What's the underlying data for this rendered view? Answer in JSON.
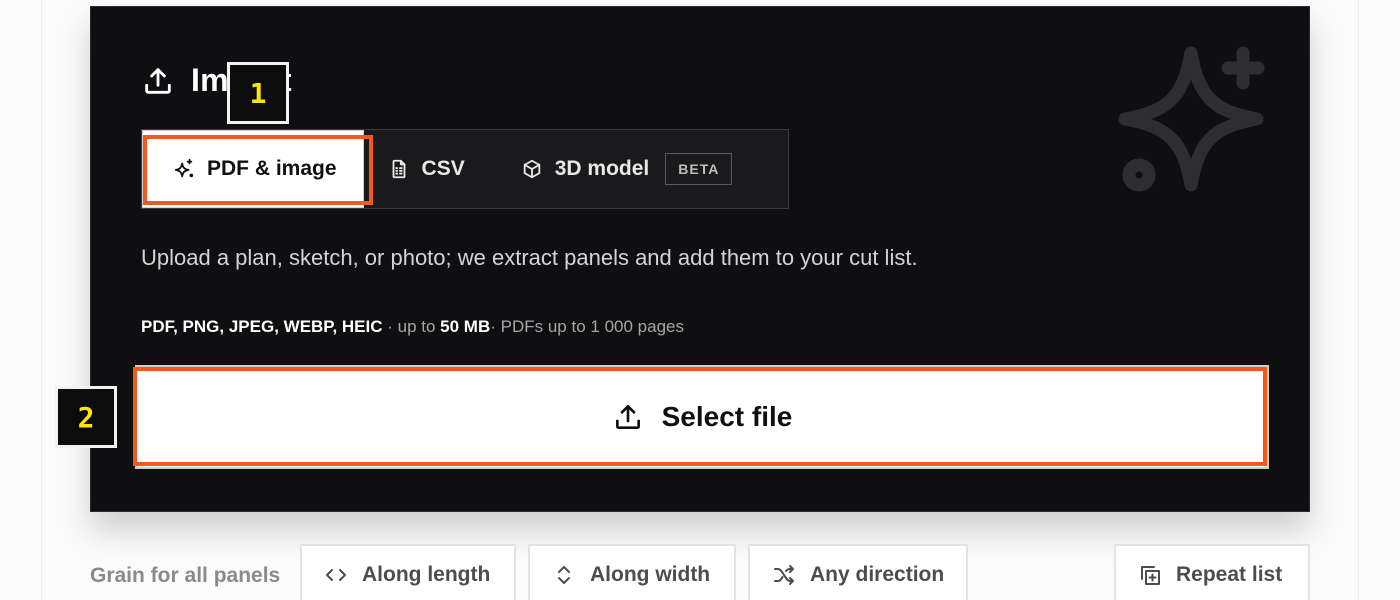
{
  "panel": {
    "title": "Import",
    "tabs": [
      {
        "label": "PDF & image",
        "icon": "sparkles-icon",
        "active": true
      },
      {
        "label": "CSV",
        "icon": "csv-file-icon",
        "active": false
      },
      {
        "label": "3D model",
        "icon": "cube-icon",
        "active": false,
        "badge": "BETA"
      }
    ],
    "description": "Upload a plan, sketch, or photo; we extract panels and add them to your cut list.",
    "formats": {
      "types": "PDF, PNG, JPEG, WEBP, HEIC",
      "sep": " · up to ",
      "size": "50 MB",
      "pages": "· PDFs up to 1 000 pages"
    },
    "select_button": "Select file"
  },
  "annotations": {
    "marker_1": "1",
    "marker_2": "2",
    "highlight_color": "#f05a1a",
    "marker_text_color": "#ffe600"
  },
  "grain": {
    "label": "Grain for all panels",
    "options": [
      "Along length",
      "Along width",
      "Any direction"
    ],
    "repeat": "Repeat list"
  }
}
